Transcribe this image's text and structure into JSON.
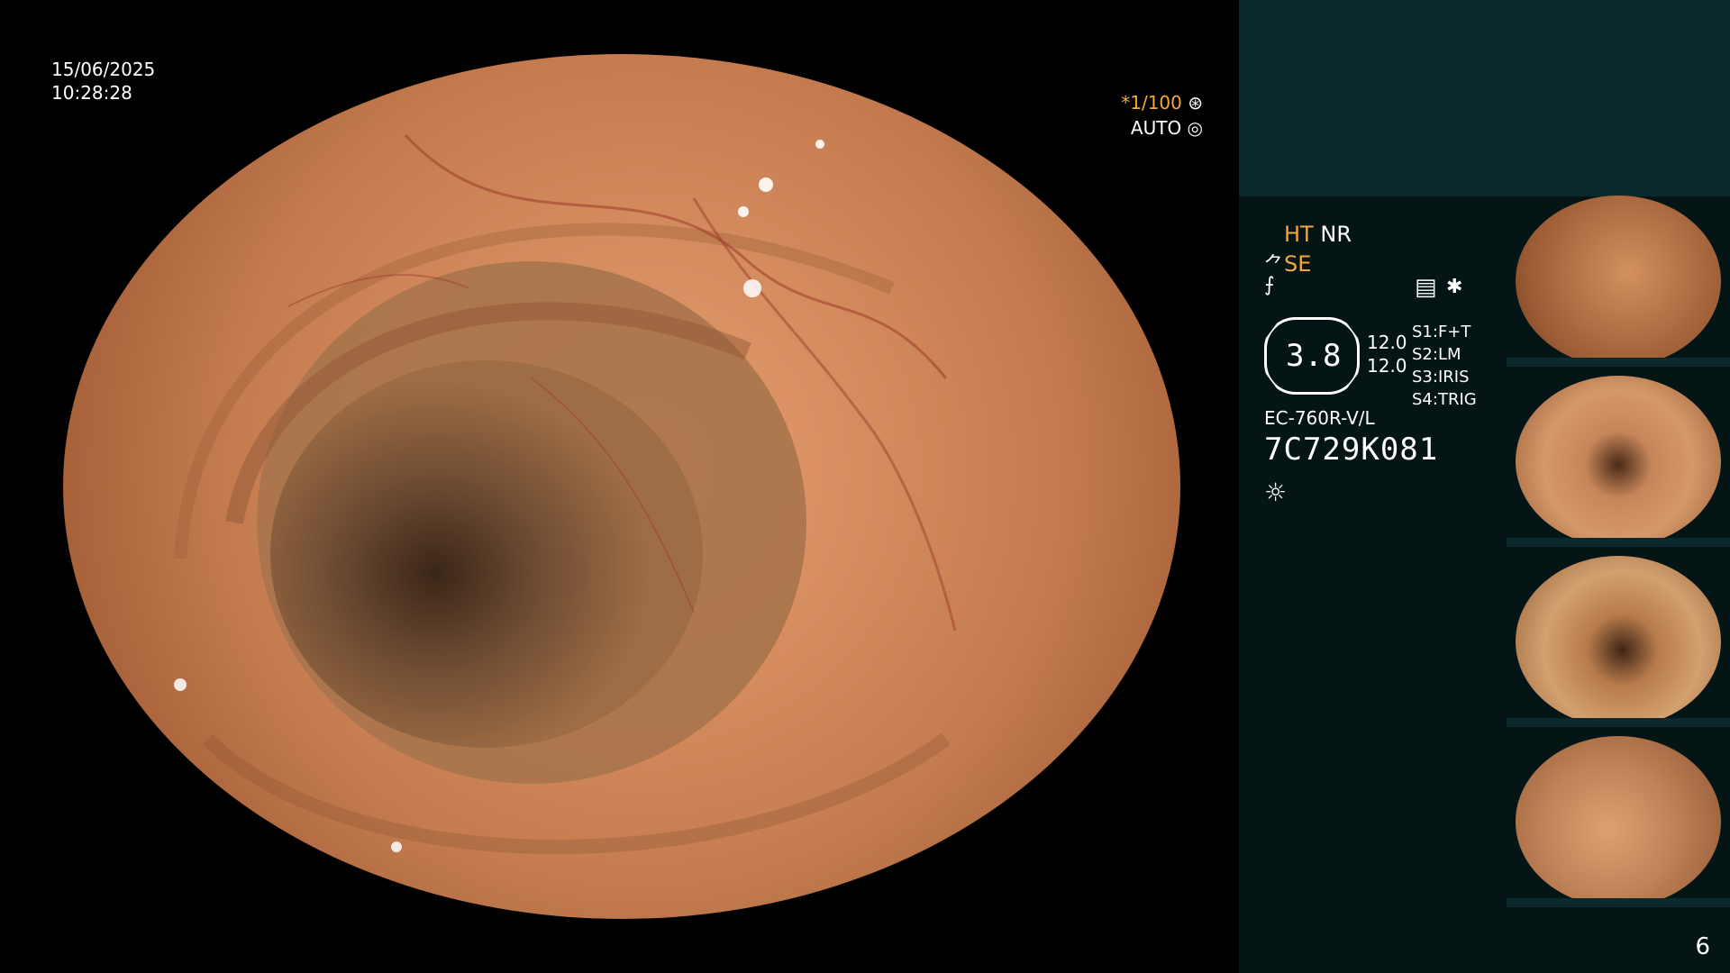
{
  "date": "15/06/2025",
  "time": "10:28:28",
  "overlay": {
    "shutter": "*1/100",
    "auto": "AUTO"
  },
  "sidebar": {
    "ht": "HT",
    "nr": "NR",
    "se": "SE",
    "octagon_value": "3.8",
    "values": [
      "12.0",
      "12.0"
    ],
    "slots": [
      {
        "label": "S1:",
        "value": "F+T"
      },
      {
        "label": "S2:",
        "value": "LM"
      },
      {
        "label": "S3:",
        "value": "IRIS"
      },
      {
        "label": "S4:",
        "value": "TRIG"
      }
    ],
    "model": "EC-760R-V/L",
    "serial": "7C729K081"
  },
  "page_number": "6",
  "colors": {
    "sidebar_bg": "#051415",
    "sidebar_top": "#0c2a2b",
    "accent_orange": "#f3a93a"
  }
}
